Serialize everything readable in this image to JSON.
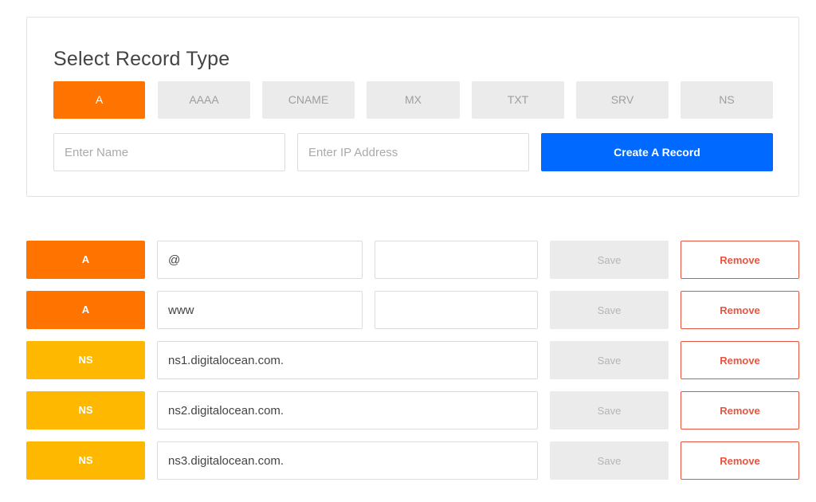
{
  "panel": {
    "title": "Select Record Type",
    "types": [
      "A",
      "AAAA",
      "CNAME",
      "MX",
      "TXT",
      "SRV",
      "NS"
    ],
    "active_type": "A",
    "name_placeholder": "Enter Name",
    "ip_placeholder": "Enter IP Address",
    "create_label": "Create A Record"
  },
  "colors": {
    "accent_orange": "#ff7300",
    "ns_yellow": "#ffb800",
    "primary_blue": "#0069ff",
    "remove_red": "#e8553f"
  },
  "records": [
    {
      "type": "A",
      "name": "@",
      "value": "",
      "save_label": "Save",
      "remove_label": "Remove"
    },
    {
      "type": "A",
      "name": "www",
      "value": "",
      "save_label": "Save",
      "remove_label": "Remove"
    },
    {
      "type": "NS",
      "name": "ns1.digitalocean.com.",
      "save_label": "Save",
      "remove_label": "Remove"
    },
    {
      "type": "NS",
      "name": "ns2.digitalocean.com.",
      "save_label": "Save",
      "remove_label": "Remove"
    },
    {
      "type": "NS",
      "name": "ns3.digitalocean.com.",
      "save_label": "Save",
      "remove_label": "Remove"
    }
  ]
}
